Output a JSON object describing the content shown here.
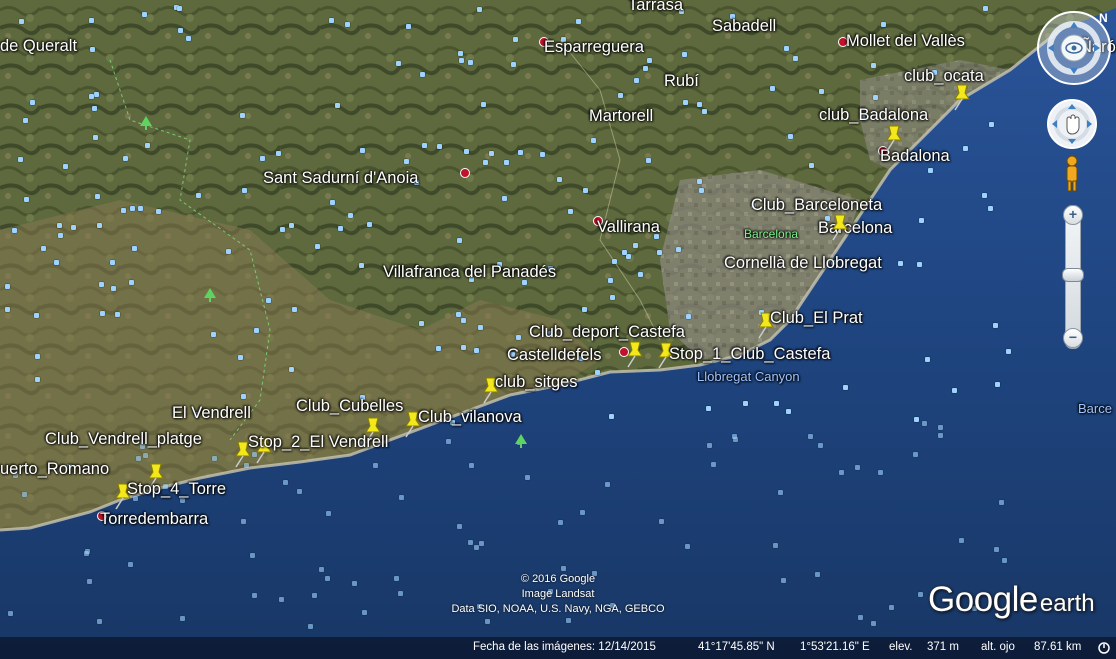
{
  "map": {
    "place_labels": [
      {
        "id": "queralt",
        "text": "de Queralt"
      },
      {
        "id": "terrassa",
        "text": "Tarrasa"
      },
      {
        "id": "sabadell",
        "text": "Sabadell"
      },
      {
        "id": "esparreguera",
        "text": "Esparreguera"
      },
      {
        "id": "mollet",
        "text": "Mollet del Vallès"
      },
      {
        "id": "granollers",
        "text": "Ñaró"
      },
      {
        "id": "rubi",
        "text": "Rubí"
      },
      {
        "id": "martorell",
        "text": "Martorell"
      },
      {
        "id": "sant-sadurni",
        "text": "Sant Sadurní d'Anoia"
      },
      {
        "id": "badalona",
        "text": "Badalona"
      },
      {
        "id": "vallirana",
        "text": "Vallirana"
      },
      {
        "id": "barcelona",
        "text": "Barcelona"
      },
      {
        "id": "vilafranca",
        "text": "Villafranca del Panadés"
      },
      {
        "id": "cornella",
        "text": "Cornellà de Llobregat"
      },
      {
        "id": "castelldefels",
        "text": "Castelldefels"
      },
      {
        "id": "el-vendrell",
        "text": "El Vendrell"
      },
      {
        "id": "puerto-romano",
        "text": "uerto_Romano"
      },
      {
        "id": "torredembarra",
        "text": "Torredembarra"
      }
    ],
    "small_labels": [
      {
        "id": "barcelona-green",
        "text": "Barcelona"
      },
      {
        "id": "llobregat-canyon",
        "text": "Llobregat Canyon"
      },
      {
        "id": "barce-edge",
        "text": "Barce"
      }
    ],
    "placemarks": [
      {
        "id": "club-ocata",
        "text": "club_ocata"
      },
      {
        "id": "club-badalona",
        "text": "club_Badalona"
      },
      {
        "id": "club-barceloneta",
        "text": "Club_Barceloneta"
      },
      {
        "id": "club-el-prat",
        "text": "Club_El Prat"
      },
      {
        "id": "club-deport-castefa",
        "text": "Club_deport_Castefa"
      },
      {
        "id": "stop-1-club-castefa",
        "text": "Stop_1_Club_Castefa"
      },
      {
        "id": "club-sitges",
        "text": "club_sitges"
      },
      {
        "id": "club-cubelles",
        "text": "Club_Cubelles"
      },
      {
        "id": "club-vilanova",
        "text": "Club_vilanova"
      },
      {
        "id": "club-vendrell-platge",
        "text": "Club_Vendrell_platge"
      },
      {
        "id": "stop-2-el-vendrell",
        "text": "Stop_2_El Vendrell"
      },
      {
        "id": "stop-4-torre",
        "text": "Stop_4_Torre"
      }
    ]
  },
  "credits": {
    "line1": "© 2016 Google",
    "line2": "Image Landsat",
    "line3": "Data SIO, NOAA, U.S. Navy, NGA, GEBCO"
  },
  "logo": {
    "google": "Google",
    "earth": "earth"
  },
  "statusbar": {
    "imagery_date": "Fecha de las imágenes: 12/14/2015",
    "latitude": "41°17'45.85\" N",
    "longitude": "1°53'21.16\" E",
    "elevation_label": "elev.",
    "elevation": "371 m",
    "eye_alt_label": "alt. ojo",
    "eye_alt": "87.61 km"
  },
  "controls": {
    "zoom_in": "+",
    "zoom_out": "−"
  },
  "colors": {
    "sea": "#1e3f72",
    "land": "#5f6b3c",
    "placemark": "#f2e81c"
  }
}
